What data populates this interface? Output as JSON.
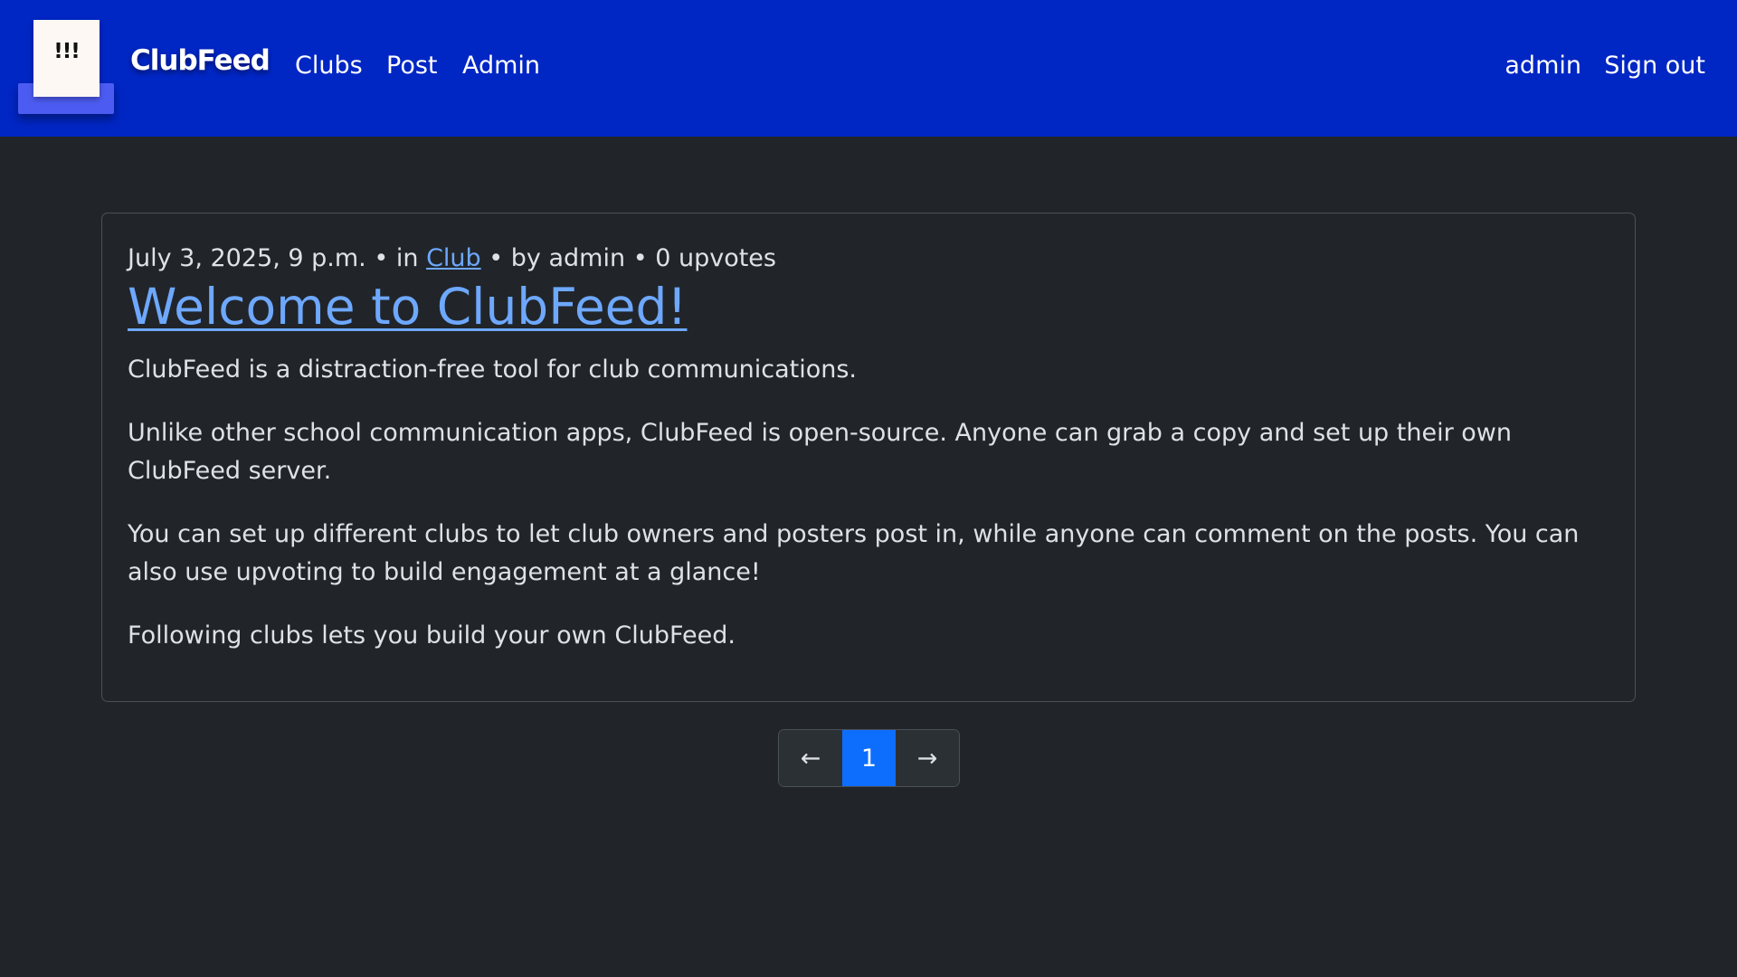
{
  "navbar": {
    "logo_mark": "!!!",
    "brand": "ClubFeed",
    "links": {
      "clubs": "Clubs",
      "post": "Post",
      "admin": "Admin"
    },
    "user": "admin",
    "sign_out": "Sign out"
  },
  "post": {
    "date": "July 3, 2025, 9 p.m.",
    "in_text": "in",
    "club": "Club",
    "by_text": "by admin",
    "upvotes": "0 upvotes",
    "title": "Welcome to ClubFeed!",
    "paragraphs": [
      "ClubFeed is a distraction-free tool for club communications.",
      "Unlike other school communication apps, ClubFeed is open-source. Anyone can grab a copy and set up their own ClubFeed server.",
      "You can set up different clubs to let club owners and posters post in, while anyone can comment on the posts. You can also use upvoting to build engagement at a glance!",
      "Following clubs lets you build your own ClubFeed."
    ]
  },
  "pagination": {
    "prev": "←",
    "current": "1",
    "next": "→"
  },
  "colors": {
    "navbar_bg": "#0026c4",
    "page_bg": "#212529",
    "link": "#6ea8fe",
    "active_page": "#0d6efd"
  }
}
